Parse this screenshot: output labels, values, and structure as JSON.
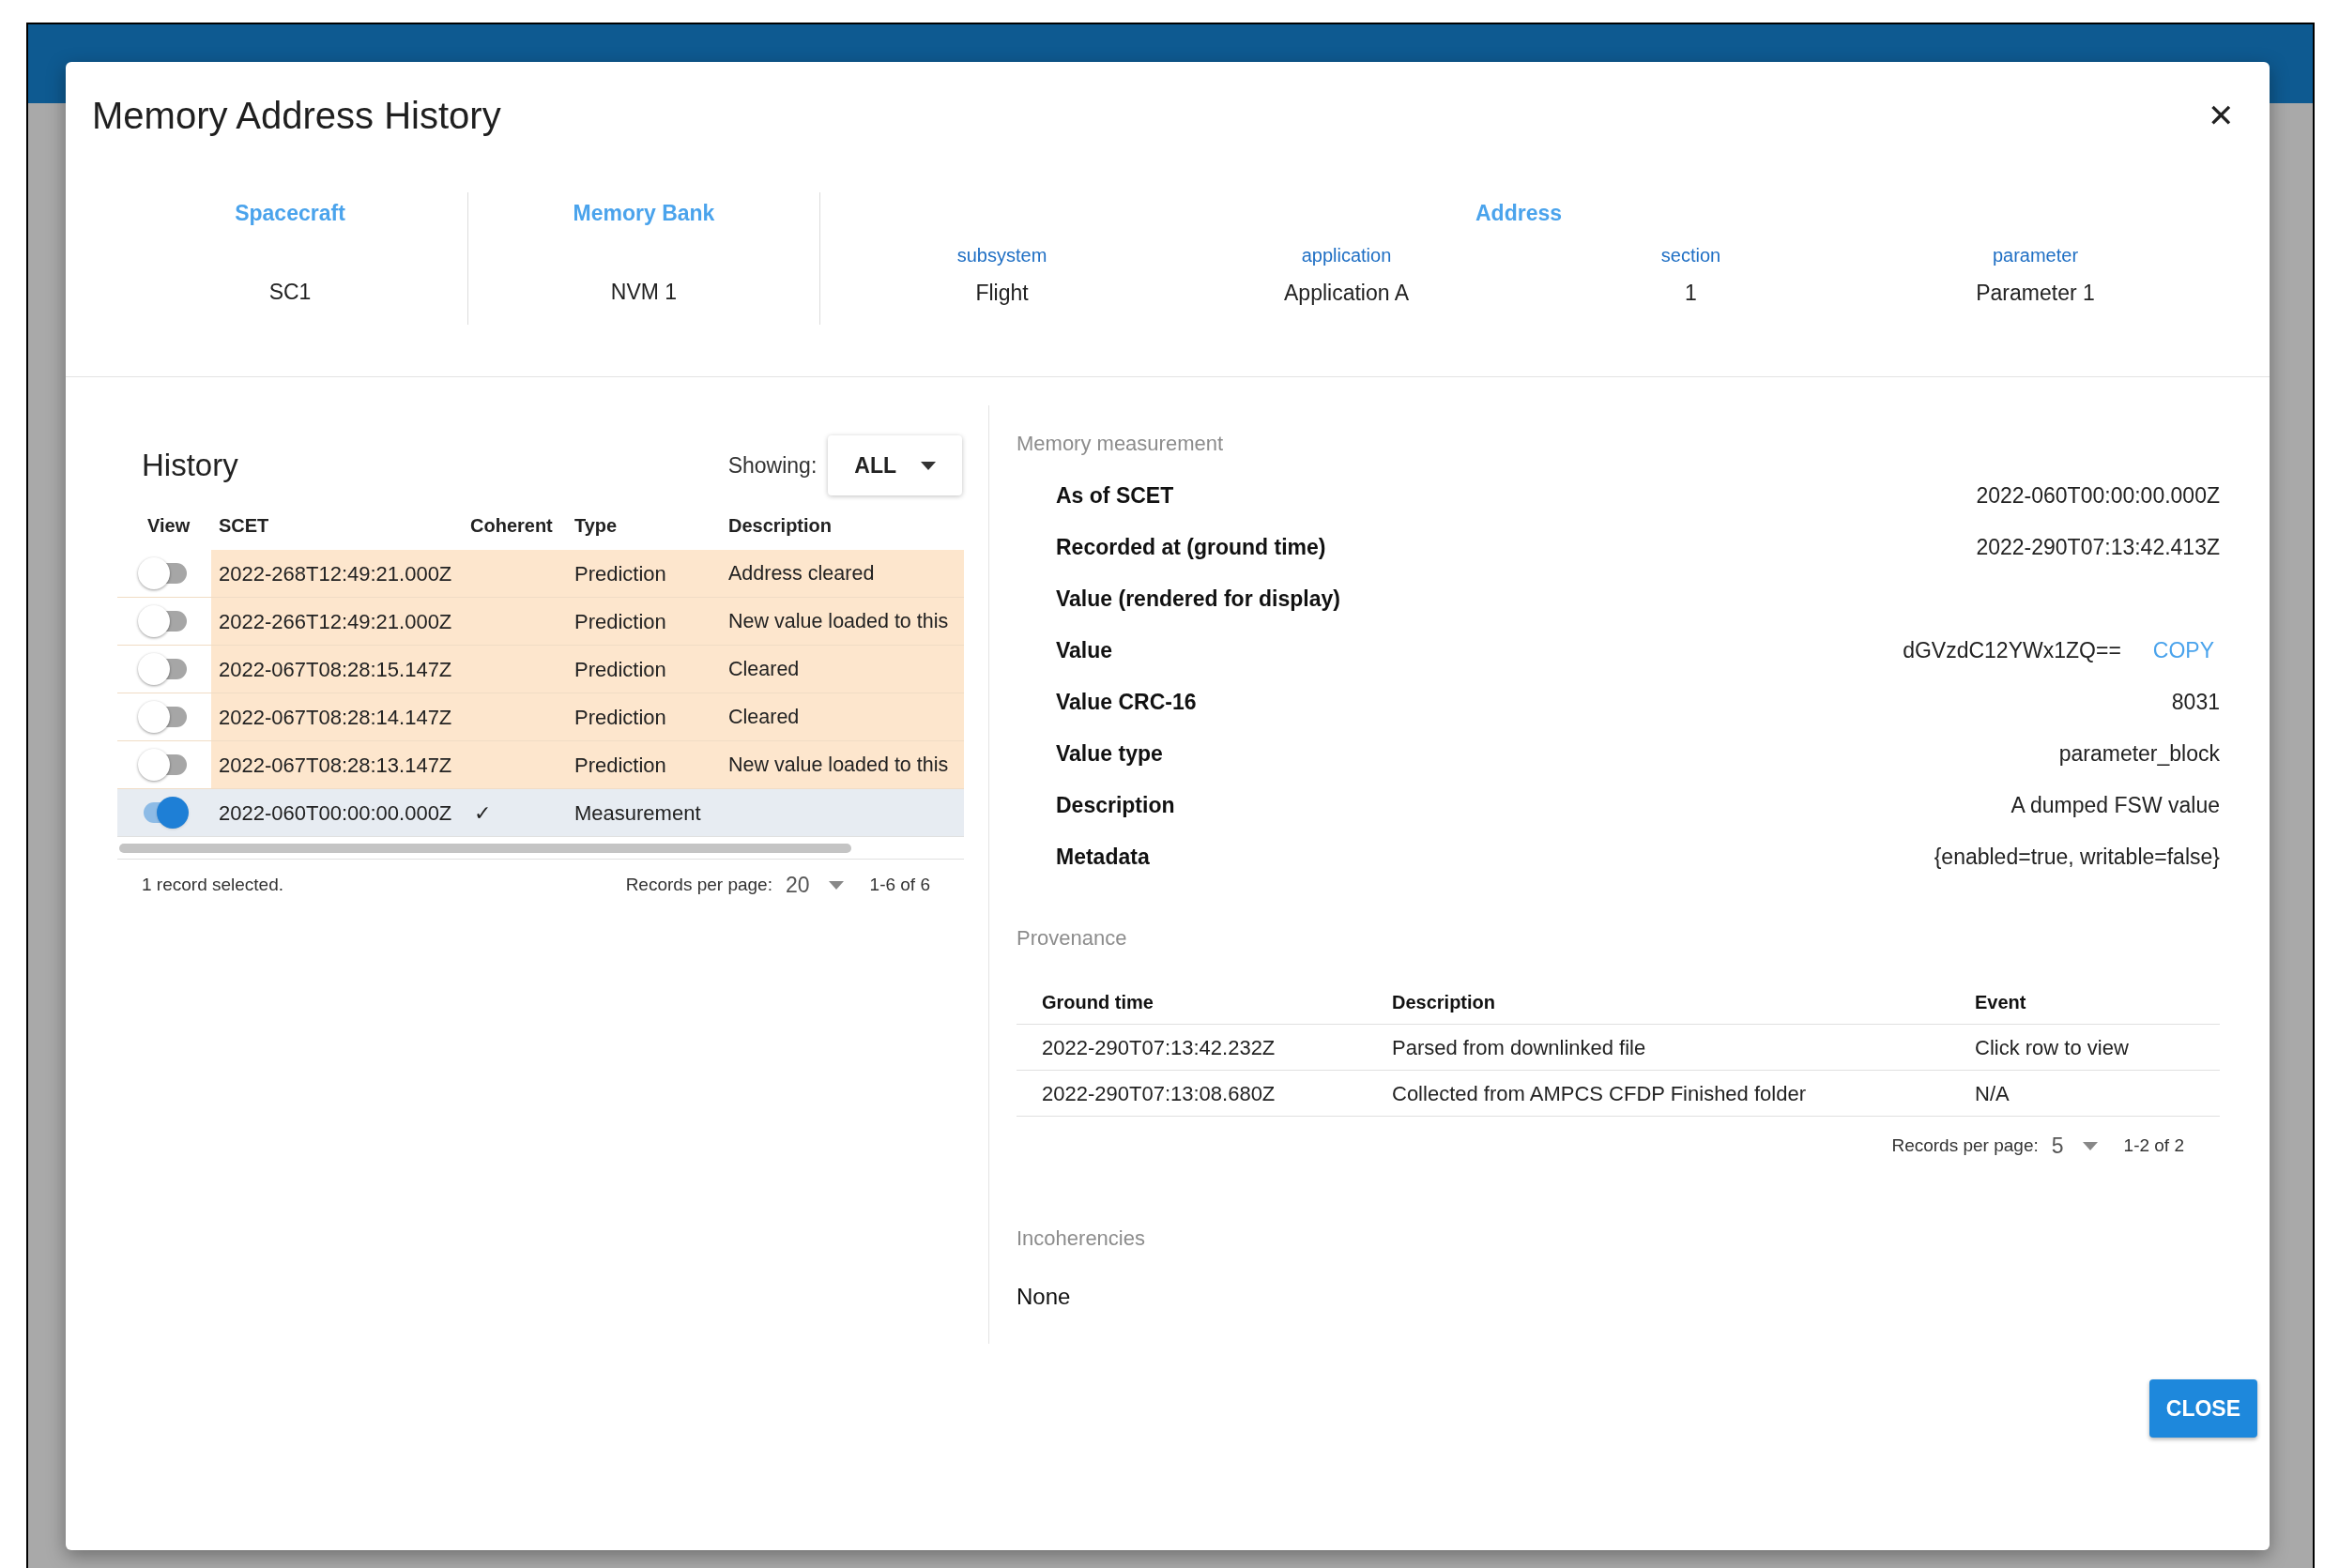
{
  "dialog": {
    "title": "Memory Address History",
    "close_icon": "✕",
    "summary": {
      "spacecraft": {
        "label": "Spacecraft",
        "value": "SC1"
      },
      "memory_bank": {
        "label": "Memory Bank",
        "value": "NVM 1"
      },
      "address": {
        "label": "Address",
        "parts": [
          {
            "label": "subsystem",
            "value": "Flight"
          },
          {
            "label": "application",
            "value": "Application A"
          },
          {
            "label": "section",
            "value": "1"
          },
          {
            "label": "parameter",
            "value": "Parameter 1"
          }
        ]
      }
    },
    "history": {
      "title": "History",
      "showing_label": "Showing:",
      "showing_value": "ALL",
      "columns": [
        "View",
        "SCET",
        "Coherent",
        "Type",
        "Description"
      ],
      "rows": [
        {
          "selected": false,
          "scet": "2022-268T12:49:21.000Z",
          "coherent": false,
          "type": "Prediction",
          "description": "Address cleared"
        },
        {
          "selected": false,
          "scet": "2022-266T12:49:21.000Z",
          "coherent": false,
          "type": "Prediction",
          "description": "New value loaded to this"
        },
        {
          "selected": false,
          "scet": "2022-067T08:28:15.147Z",
          "coherent": false,
          "type": "Prediction",
          "description": "Cleared"
        },
        {
          "selected": false,
          "scet": "2022-067T08:28:14.147Z",
          "coherent": false,
          "type": "Prediction",
          "description": "Cleared"
        },
        {
          "selected": false,
          "scet": "2022-067T08:28:13.147Z",
          "coherent": false,
          "type": "Prediction",
          "description": "New value loaded to this"
        },
        {
          "selected": true,
          "scet": "2022-060T00:00:00.000Z",
          "coherent": true,
          "coherent_mark": "✓",
          "type": "Measurement"
        }
      ],
      "status": "1 record selected.",
      "per_page_label": "Records per page:",
      "per_page": "20",
      "range": "1-6 of 6"
    },
    "measurement": {
      "title": "Memory measurement",
      "fields": [
        {
          "label": "As of SCET",
          "value": "2022-060T00:00:00.000Z"
        },
        {
          "label": "Recorded at (ground time)",
          "value": "2022-290T07:13:42.413Z"
        },
        {
          "label": "Value (rendered for display)"
        },
        {
          "label": "Value",
          "value": "dGVzdC12YWx1ZQ==",
          "action": "COPY"
        },
        {
          "label": "Value CRC-16",
          "value": "8031"
        },
        {
          "label": "Value type",
          "value": "parameter_block"
        },
        {
          "label": "Description",
          "value": "A dumped FSW value"
        },
        {
          "label": "Metadata",
          "value": "{enabled=true, writable=false}"
        }
      ]
    },
    "provenance": {
      "title": "Provenance",
      "columns": [
        "Ground time",
        "Description",
        "Event"
      ],
      "rows": [
        [
          "2022-290T07:13:42.232Z",
          "Parsed from downlinked file",
          "Click row to view"
        ],
        [
          "2022-290T07:13:08.680Z",
          "Collected from AMPCS CFDP Finished folder",
          "N/A"
        ]
      ],
      "per_page_label": "Records per page:",
      "per_page": "5",
      "range": "1-2 of 2"
    },
    "incoherencies": {
      "title": "Incoherencies",
      "value": "None"
    },
    "buttons": [
      "CLOSE"
    ]
  }
}
